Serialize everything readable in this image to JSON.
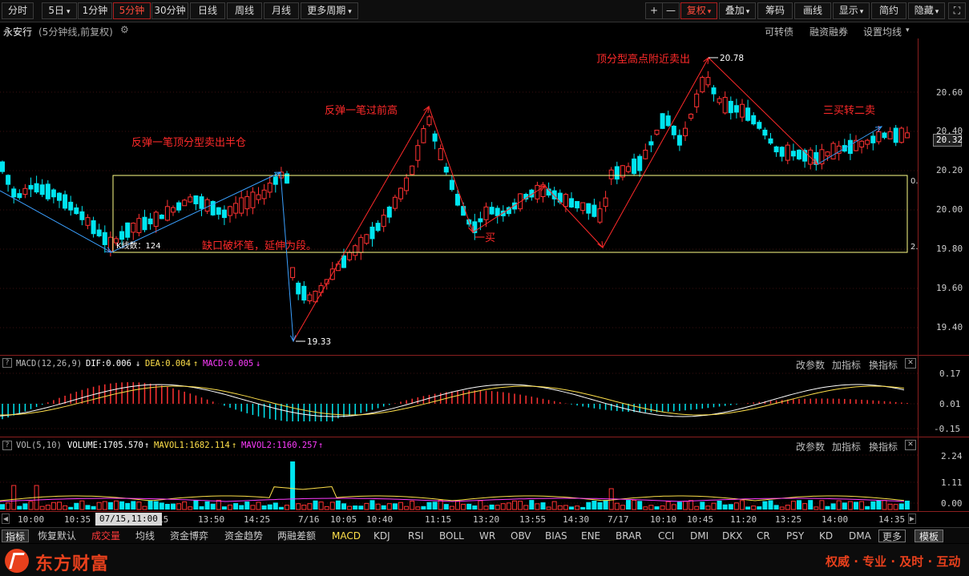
{
  "toolbar": {
    "periods": [
      "分时",
      "5日",
      "1分钟",
      "5分钟",
      "30分钟",
      "日线",
      "周线",
      "月线",
      "更多周期"
    ],
    "period_5d_arrow": "▾",
    "more_arrow": "▾",
    "plus": "+",
    "minus": "—",
    "right_buttons": [
      "复权",
      "叠加",
      "筹码",
      "画线",
      "显示",
      "简约",
      "隐藏"
    ],
    "right_arrows": "▾",
    "expand": "⛶"
  },
  "info": {
    "stock_name": "永安行",
    "subtitle": "(5分钟线,前复权)",
    "links": [
      "可转债",
      "融资融券",
      "设置均线"
    ]
  },
  "colors": {
    "up": "#ff3232",
    "down": "#00e5f0",
    "ma1": "#ffffff",
    "ma2": "#ffe04a",
    "ma3": "#ff3cff",
    "ann": "#ff2a2a",
    "blue": "#3aa0ff"
  },
  "main_chart": {
    "price_ticks": [
      "20.60",
      "20.40",
      "20.20",
      "20.00",
      "19.80",
      "19.60",
      "19.40"
    ],
    "current_price": "20.32",
    "box_right_labels": [
      "0.",
      "2."
    ],
    "high_label": "20.78",
    "low_label": "19.33",
    "kcount_label": "K线数：124",
    "annotations": [
      "反弹一笔顶分型卖出半仓",
      "反弹一笔过前高",
      "顶分型高点附近卖出",
      "三买转二卖",
      "缺口破坏笔，延伸为段。",
      "一买"
    ]
  },
  "time_axis": {
    "labels": [
      "10:00",
      "10:35",
      "15",
      "13:50",
      "14:25",
      "7/16",
      "10:05",
      "10:40",
      "11:15",
      "13:20",
      "13:55",
      "14:30",
      "7/17",
      "10:10",
      "10:45",
      "11:20",
      "13:25",
      "14:00",
      "14:35"
    ],
    "cursor_label": "07/15,11:00"
  },
  "macd": {
    "name": "MACD(12,26,9)",
    "dif": "DIF:0.006",
    "dea": "DEA:0.004",
    "macd": "MACD:0.005",
    "arrows": [
      "↓",
      "↑",
      "↓"
    ],
    "ticks": [
      "0.17",
      "0.01",
      "-0.15"
    ],
    "buttons": [
      "改参数",
      "加指标",
      "换指标"
    ],
    "close": "✕",
    "help": "?"
  },
  "vol": {
    "name": "VOL(5,10)",
    "volume": "VOLUME:1705.570",
    "mavol1": "MAVOL1:1682.114",
    "mavol2": "MAVOL2:1160.257",
    "arrows": [
      "↑",
      "↑",
      "↑"
    ],
    "ticks": [
      "2.24",
      "1.11",
      "0.00"
    ],
    "buttons": [
      "改参数",
      "加指标",
      "换指标"
    ],
    "close": "✕",
    "help": "?"
  },
  "bottom_tabs": [
    "指标",
    "恢复默认",
    "成交量",
    "均线",
    "资金博弈",
    "资金趋势",
    "两融差额",
    "MACD",
    "KDJ",
    "RSI",
    "BOLL",
    "WR",
    "OBV",
    "BIAS",
    "ENE",
    "BRAR",
    "CCI",
    "DMI",
    "DKX",
    "CR",
    "PSY",
    "KD",
    "DMA",
    "更多",
    "模板"
  ],
  "footer": {
    "brand": "东方财富",
    "slogan": "权威 · 专业 · 及时 · 互动"
  }
}
